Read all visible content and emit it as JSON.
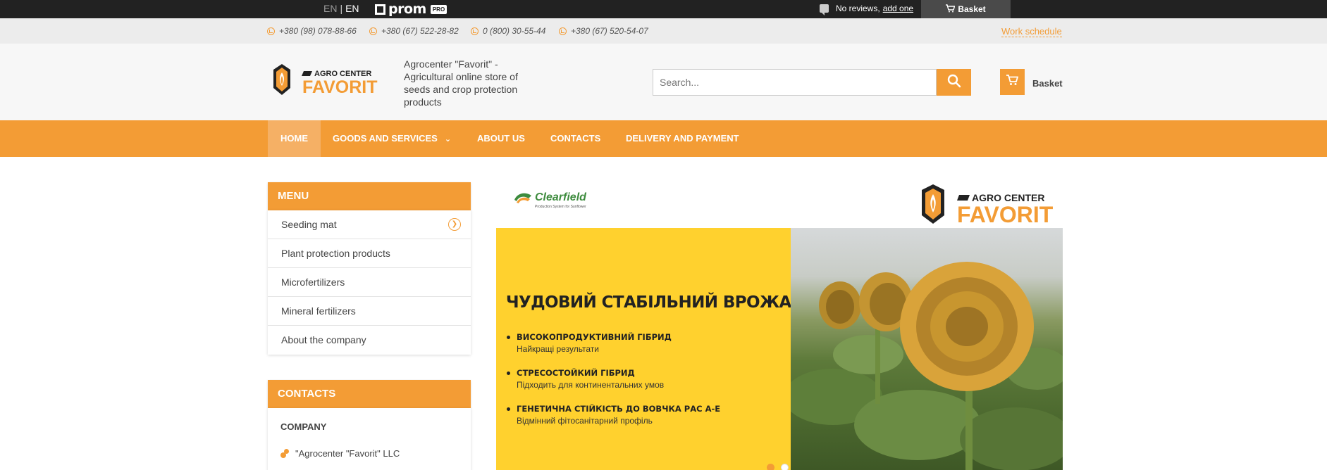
{
  "topbar": {
    "lang_inactive": "EN",
    "lang_active": "EN",
    "prom_brand": "prom",
    "prom_badge": "PRO",
    "reviews_text": "No reviews,",
    "add_review": "add one",
    "basket": "Basket"
  },
  "phones": [
    "+380 (98) 078-88-66",
    "+380 (67) 522-28-82",
    "0 (800) 30-55-44",
    "+380 (67) 520-54-07"
  ],
  "work_schedule": "Work schedule",
  "header": {
    "logo_top": "AGRO CENTER",
    "logo_bottom": "FAVORIT",
    "tagline": "Agrocenter \"Favorit\" - Agricultural online store of seeds and crop protection products",
    "search_placeholder": "Search...",
    "cart_label": "Basket"
  },
  "nav": {
    "items": [
      "HOME",
      "GOODS AND SERVICES",
      "ABOUT US",
      "CONTACTS",
      "DELIVERY AND PAYMENT"
    ]
  },
  "sidebar": {
    "menu_title": "MENU",
    "menu_items": [
      "Seeding mat",
      "Plant protection products",
      "Microfertilizers",
      "Mineral fertilizers",
      "About the company"
    ],
    "contacts_title": "CONTACTS",
    "company_label": "COMPANY",
    "company_name": "\"Agrocenter \"Favorit\" LLC"
  },
  "banner": {
    "brand": "Clearfield",
    "brand_sub": "Production System for Sunflower",
    "logo_top": "AGRO CENTER",
    "logo_bottom": "FAVORIT",
    "title": "ЧУДОВИЙ СТАБІЛЬНИЙ ВРОЖАЙ",
    "bullets": [
      {
        "head": "ВИСОКОПРОДУКТИВНИЙ ГІБРИД",
        "sub": "Найкращі результати"
      },
      {
        "head": "СТРЕСОСТОЙКИЙ ГІБРИД",
        "sub": "Підходить для континентальних умов"
      },
      {
        "head": "ГЕНЕТИЧНА СТІЙКІСТЬ ДО ВОВЧКА РАС А-Е",
        "sub": "Відмінний фітосанітарний профіль"
      }
    ]
  },
  "colors": {
    "accent": "#f39c35",
    "topbar": "#222222",
    "banner_yellow": "#ffd12e"
  }
}
